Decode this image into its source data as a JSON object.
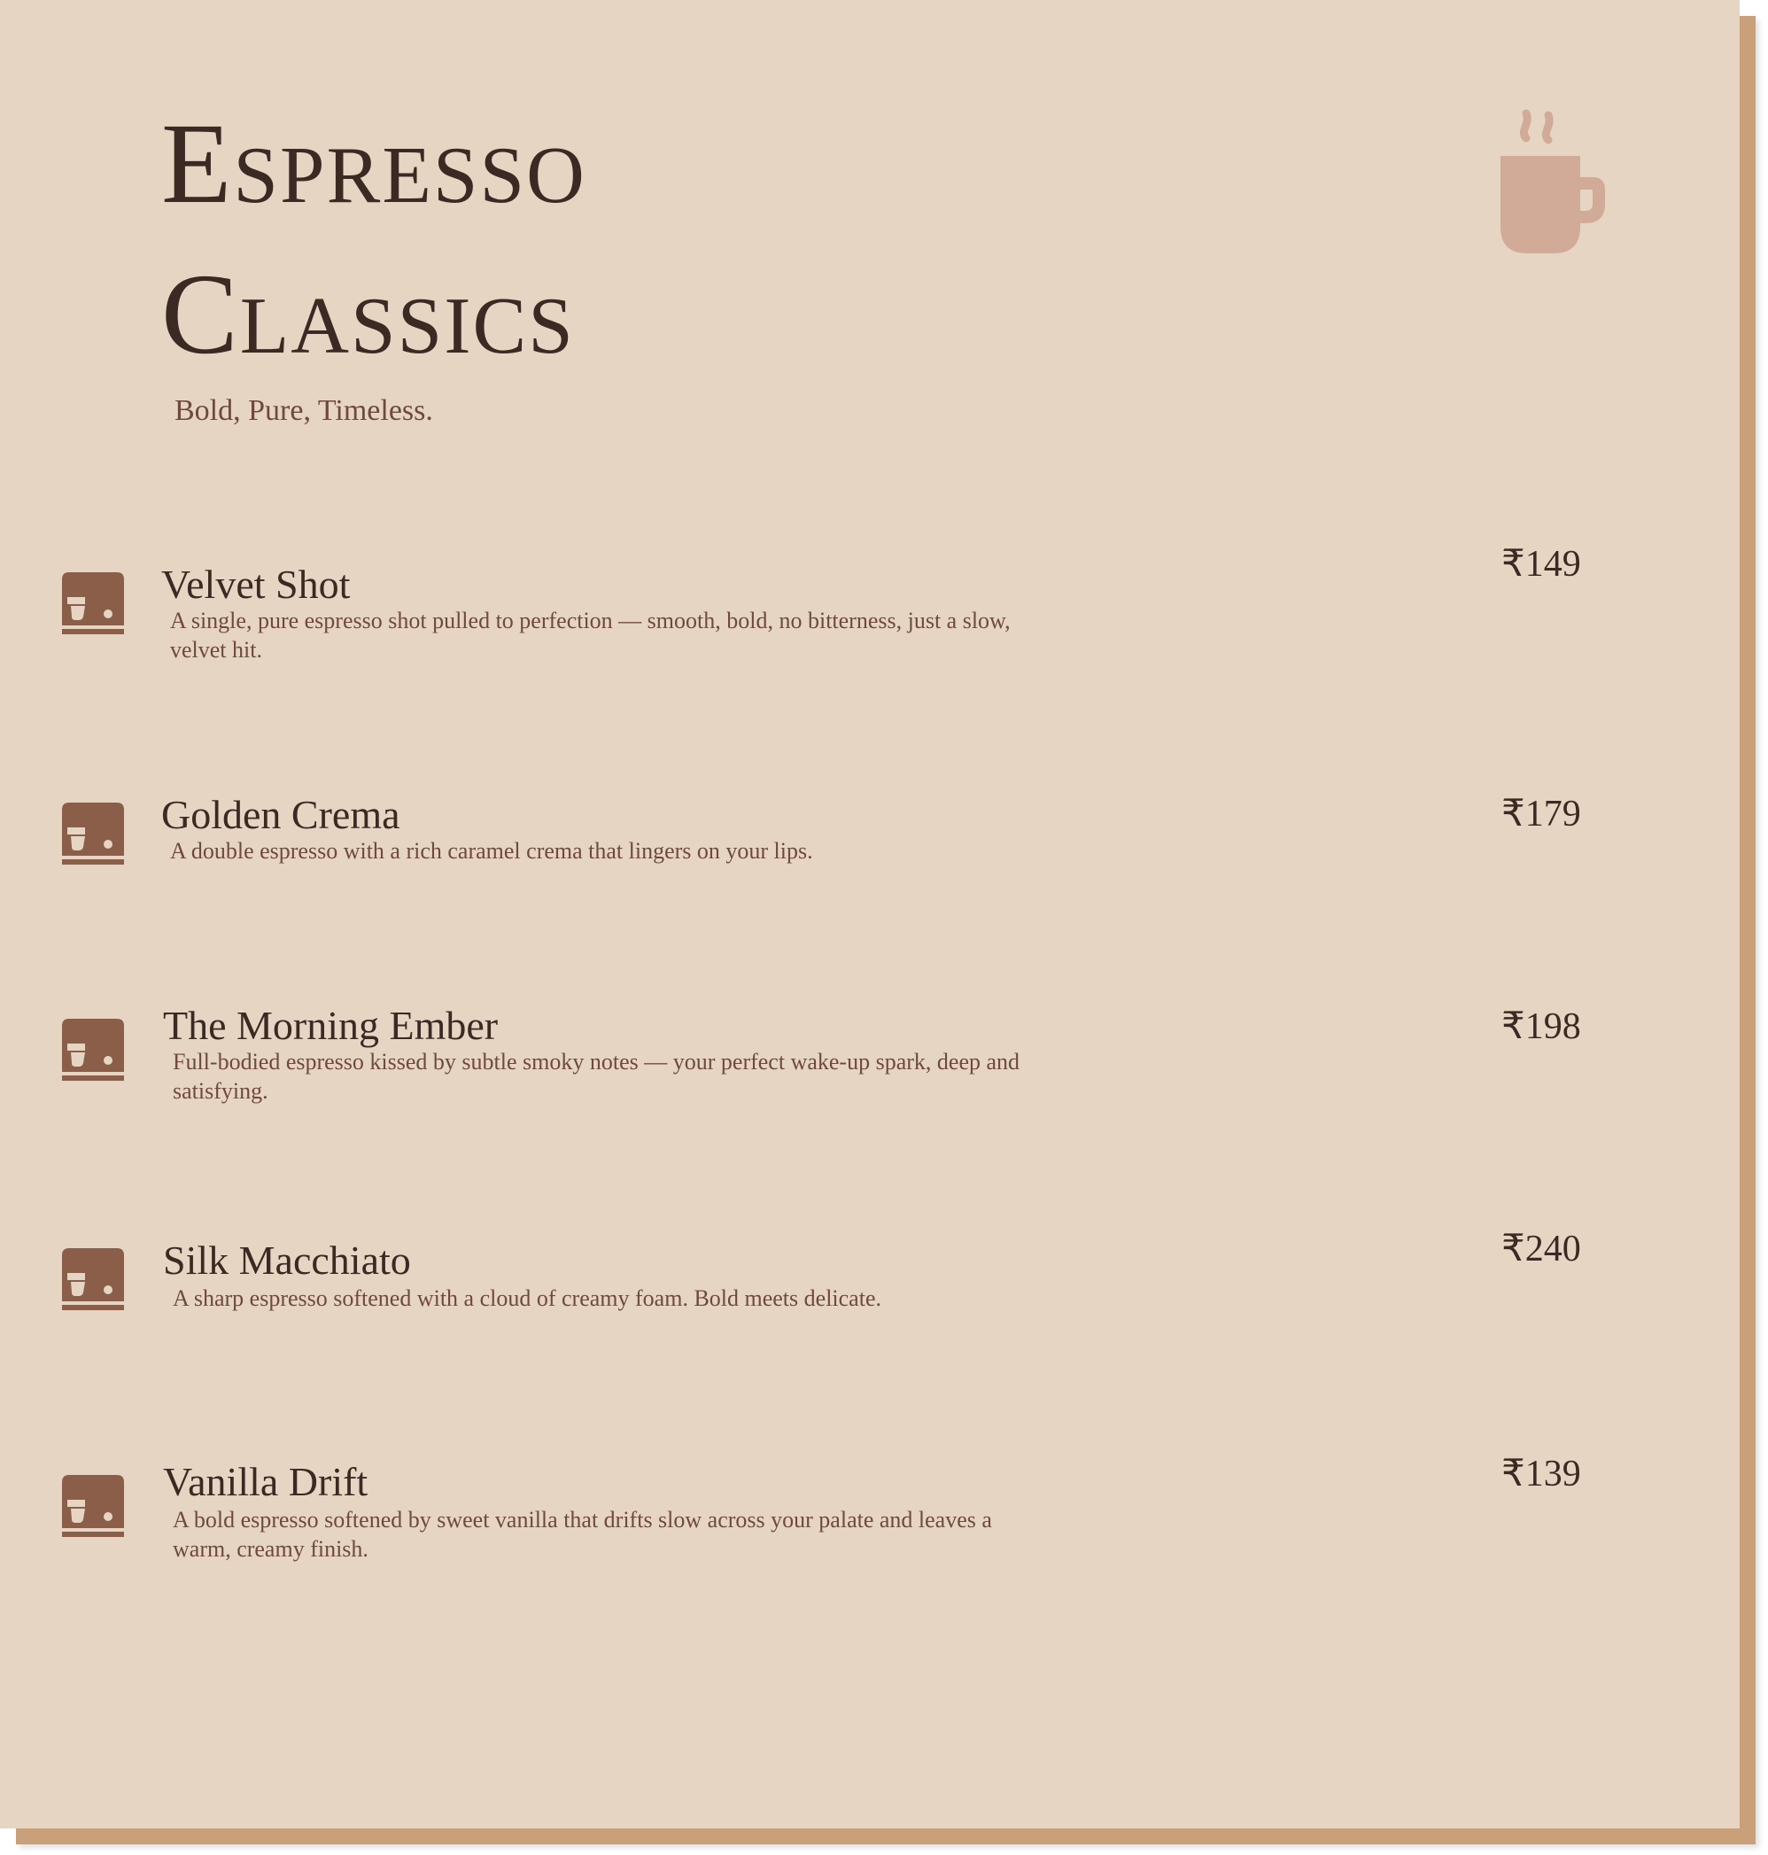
{
  "menu": {
    "title_line1": "Espresso",
    "title_line2": "Classics",
    "subtitle": "Bold, Pure, Timeless.",
    "header_icon": "coffee-cup-steam-icon",
    "item_icon": "espresso-machine-icon",
    "colors": {
      "background": "#e7d5c3",
      "title": "#3b2a23",
      "text": "#6f4a3c",
      "icon": "#8b5e4a",
      "cup": "#d1ab98",
      "shadow": "#c9a07a"
    },
    "items": [
      {
        "name": "Velvet Shot",
        "description": "A single, pure espresso shot pulled to perfection — smooth, bold, no bitterness, just a slow, velvet hit.",
        "price": "₹149"
      },
      {
        "name": "Golden Crema",
        "description": "A double espresso with a rich caramel crema that lingers on your lips.",
        "price": "₹179"
      },
      {
        "name": "The Morning Ember",
        "description": "Full-bodied espresso kissed by subtle smoky notes — your perfect wake-up spark, deep and satisfying.",
        "price": "₹198"
      },
      {
        "name": "Silk Macchiato",
        "description": "A sharp espresso softened with a cloud of creamy foam. Bold meets delicate.",
        "price": "₹240"
      },
      {
        "name": "Vanilla Drift",
        "description": "A bold espresso softened by sweet vanilla that drifts slow across your palate and leaves a warm, creamy finish.",
        "price": "₹139"
      }
    ]
  }
}
